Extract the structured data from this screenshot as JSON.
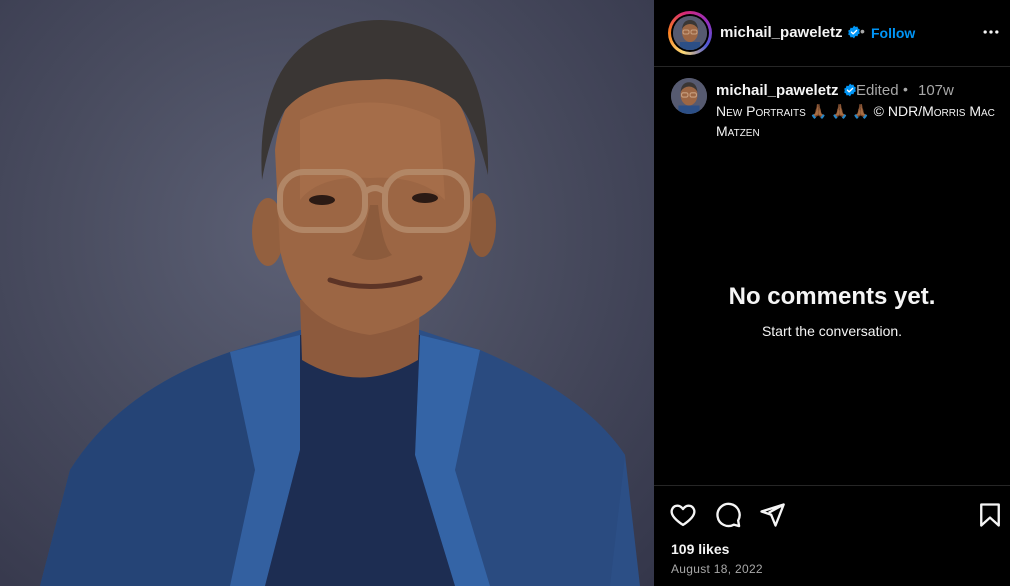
{
  "post": {
    "username": "michail_paweletz",
    "verified": true,
    "follow_label": "Follow",
    "separator": "•",
    "edited_label": "Edited",
    "time_ago": "107w",
    "caption": "New Portraits 🙏🏾 🙏🏾 🙏🏾 © NDR/Morris Mac Matzen",
    "likes": "109 likes",
    "date": "August 18, 2022"
  },
  "comments": {
    "empty_title": "No comments yet.",
    "empty_subtitle": "Start the conversation."
  },
  "icons": {
    "more": "more-options-icon",
    "like": "heart-icon",
    "comment": "comment-icon",
    "share": "send-icon",
    "save": "bookmark-icon",
    "verified": "verified-badge-icon"
  },
  "colors": {
    "background": "#000000",
    "accent": "#0095f6",
    "secondary_text": "#a8a8a8",
    "divider": "#262626"
  }
}
